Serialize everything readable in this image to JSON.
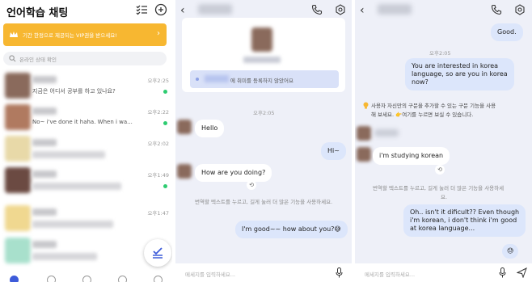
{
  "list_panel": {
    "title": "언어학습 채팅",
    "vip_banner": "기간 한정으로 제공되는 VIP권을 받으세요!",
    "search_placeholder": "온라인 상태 확인",
    "chats": [
      {
        "preview": "지금은 어디서 공부를 하고 있나요?",
        "time": "오후2:25",
        "online": true,
        "avatar_color": "#8a6a5c"
      },
      {
        "preview": "No~ i've done it haha. When i wa...",
        "time": "오후2:22",
        "online": true,
        "avatar_color": "#b07a60"
      },
      {
        "preview": "",
        "time": "오후2:02",
        "online": false,
        "avatar_color": "#e8d9a8"
      },
      {
        "preview": "",
        "time": "오후1:49",
        "online": true,
        "avatar_color": "#6b4a42"
      },
      {
        "preview": "",
        "time": "오후1:47",
        "online": false,
        "avatar_color": "#f0d890"
      },
      {
        "preview": "",
        "time": "",
        "online": false,
        "avatar_color": "#a8e0cc"
      }
    ]
  },
  "chat_panel_1": {
    "profile_note": "에 취미를 등록하지 않았어요",
    "date": "오후2:05",
    "messages": [
      {
        "dir": "in",
        "text": "Hello"
      },
      {
        "dir": "out",
        "text": "Hi~"
      },
      {
        "dir": "in",
        "text": "How are you doing?"
      },
      {
        "dir": "out",
        "text": "I'm good~~ how about you?😅"
      }
    ],
    "hint": "번역할 텍스트를 누르고, 길게 눌러 더 많은 기능을 사용하세요.",
    "input_placeholder": "메세지를 입력하세요..."
  },
  "chat_panel_2": {
    "top_bubble": "Good.",
    "date": "오후2:05",
    "question": [
      "You are interested in korea",
      "language, so are you in korea",
      "now?"
    ],
    "notice": [
      "사용자 자신만의 구문을 추가할 수 있는 구문 기능을 사용",
      "해 보세요. 👉여기를 누르면 보실 수 있습니다."
    ],
    "reply": "i'm studying korean",
    "hint": "번역할 텍스트를 누르고, 길게 눌러 더 많은 기능을 사용하세",
    "hint2": "요.",
    "answer": [
      "Oh.. isn't it dificult?? Even though",
      "i'm korean, i don't think i'm good",
      "at korea language..."
    ],
    "emoji": "😓",
    "input_placeholder": "메세지를 입력하세요..."
  },
  "colors": {
    "accent": "#f7b731",
    "out_bubble": "#dce6fb",
    "chat_bg": "#eef0f8",
    "online": "#2ecc71"
  }
}
